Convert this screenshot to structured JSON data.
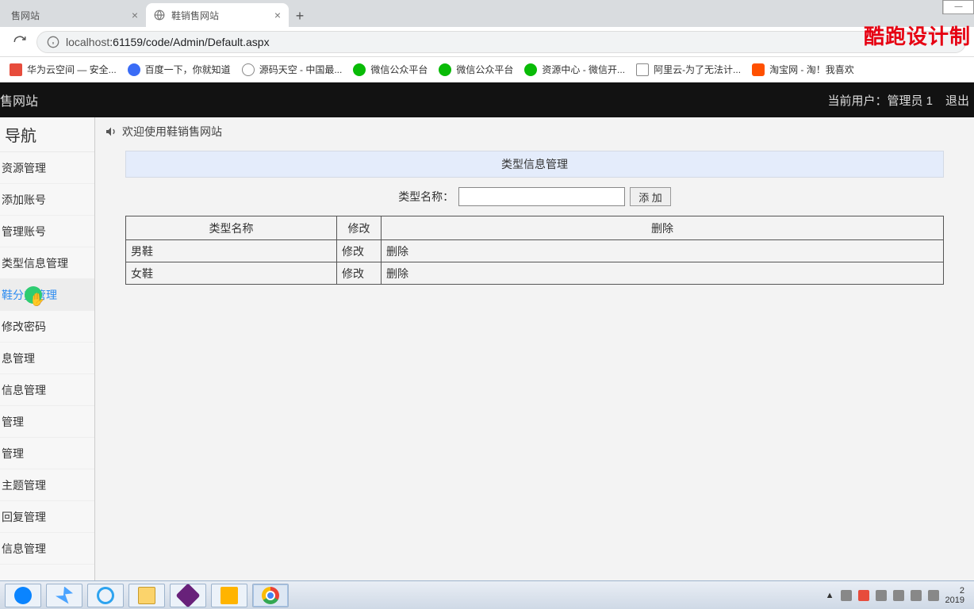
{
  "window": {
    "minimize": "—"
  },
  "tabs": [
    {
      "title": "售网站",
      "active": false
    },
    {
      "title": "鞋销售网站",
      "active": true
    }
  ],
  "address": {
    "host": "localhost",
    "port_path": ":61159/code/Admin/Default.aspx"
  },
  "watermark": "酷跑设计制",
  "bookmarks": [
    {
      "label": "华为云空间 — 安全...",
      "icon": "fav-huawei"
    },
    {
      "label": "百度一下，你就知道",
      "icon": "fav-baidu"
    },
    {
      "label": "源码天空 - 中国最...",
      "icon": "fav-globe"
    },
    {
      "label": "微信公众平台",
      "icon": "fav-wechat"
    },
    {
      "label": "微信公众平台",
      "icon": "fav-wechat"
    },
    {
      "label": "资源中心 - 微信开...",
      "icon": "fav-wechat"
    },
    {
      "label": "阿里云-为了无法计...",
      "icon": "fav-ali"
    },
    {
      "label": "淘宝网 - 淘！我喜欢",
      "icon": "fav-taobao"
    }
  ],
  "header": {
    "site_name": "售网站",
    "current_user_label": "当前用户：管理员 1",
    "logout": "退出"
  },
  "sidebar": {
    "title": "导航",
    "items": [
      "资源管理",
      "添加账号",
      "管理账号",
      "类型信息管理",
      "鞋分类管理",
      "修改密码",
      "息管理",
      "信息管理",
      "管理",
      "管理",
      "主题管理",
      "回复管理",
      "信息管理"
    ],
    "active_index": 4
  },
  "welcome": "欢迎使用鞋销售网站",
  "panel": {
    "title": "类型信息管理",
    "search_label": "类型名称：",
    "add_button": "添 加",
    "columns": {
      "name": "类型名称",
      "edit": "修改",
      "delete": "删除"
    },
    "rows": [
      {
        "name": "男鞋",
        "edit": "修改",
        "delete": "删除"
      },
      {
        "name": "女鞋",
        "edit": "修改",
        "delete": "删除"
      }
    ]
  },
  "tray": {
    "up_arrow": "▲",
    "time": "2",
    "date": "2019"
  }
}
